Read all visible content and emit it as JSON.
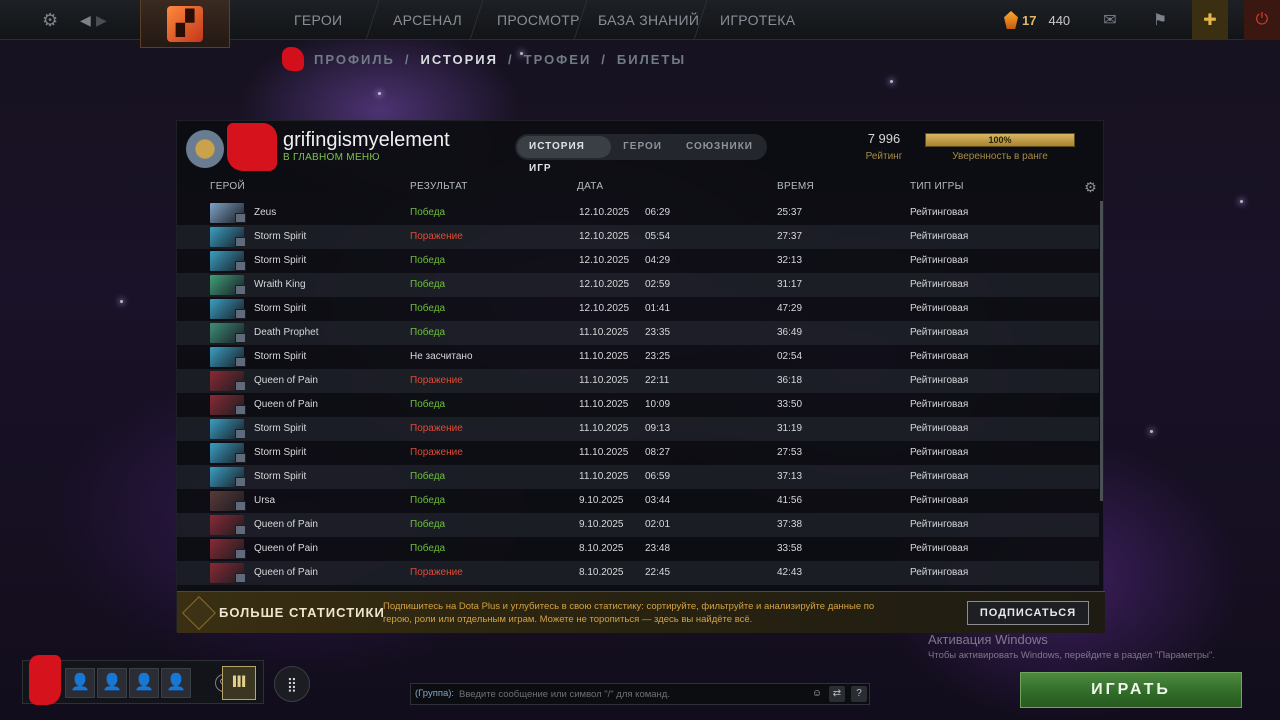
{
  "topbar": {
    "nav": [
      "ГЕРОИ",
      "АРСЕНАЛ",
      "ПРОСМОТР",
      "БАЗА ЗНАНИЙ",
      "ИГРОТЕКА"
    ],
    "currency_level": "17",
    "currency_shards": "440"
  },
  "subnav": {
    "items": [
      "ПРОФИЛЬ",
      "ИСТОРИЯ",
      "ТРОФЕИ",
      "БИЛЕТЫ"
    ],
    "active": "ИСТОРИЯ"
  },
  "profile": {
    "name": "grifingismyelement",
    "status": "В ГЛАВНОМ МЕНЮ",
    "tabs": [
      "ИСТОРИЯ ИГР",
      "ГЕРОИ",
      "СОЮЗНИКИ"
    ],
    "active_tab": "ИСТОРИЯ ИГР",
    "rating_value": "7 996",
    "rating_label": "Рейтинг",
    "confidence_fraction": 1.0,
    "confidence_text": "100%",
    "confidence_label": "Уверенность в ранге"
  },
  "table": {
    "headers": {
      "hero": "ГЕРОЙ",
      "result": "РЕЗУЛЬТАТ",
      "date": "ДАТА",
      "duration": "ВРЕМЯ",
      "type": "ТИП ИГРЫ"
    },
    "rows": [
      {
        "hero": "Zeus",
        "result": "Победа",
        "status": "win",
        "date": "12.10.2025",
        "time": "06:29",
        "duration": "25:37",
        "type": "Рейтинговая",
        "color": "#7fa3c8"
      },
      {
        "hero": "Storm Spirit",
        "result": "Поражение",
        "status": "loss",
        "date": "12.10.2025",
        "time": "05:54",
        "duration": "27:37",
        "type": "Рейтинговая",
        "color": "#3a9fc4"
      },
      {
        "hero": "Storm Spirit",
        "result": "Победа",
        "status": "win",
        "date": "12.10.2025",
        "time": "04:29",
        "duration": "32:13",
        "type": "Рейтинговая",
        "color": "#3a9fc4"
      },
      {
        "hero": "Wraith King",
        "result": "Победа",
        "status": "win",
        "date": "12.10.2025",
        "time": "02:59",
        "duration": "31:17",
        "type": "Рейтинговая",
        "color": "#3fa07a"
      },
      {
        "hero": "Storm Spirit",
        "result": "Победа",
        "status": "win",
        "date": "12.10.2025",
        "time": "01:41",
        "duration": "47:29",
        "type": "Рейтинговая",
        "color": "#3a9fc4"
      },
      {
        "hero": "Death Prophet",
        "result": "Победа",
        "status": "win",
        "date": "11.10.2025",
        "time": "23:35",
        "duration": "36:49",
        "type": "Рейтинговая",
        "color": "#3d8f7a"
      },
      {
        "hero": "Storm Spirit",
        "result": "Не засчитано",
        "status": "nc",
        "date": "11.10.2025",
        "time": "23:25",
        "duration": "02:54",
        "type": "Рейтинговая",
        "color": "#3a9fc4"
      },
      {
        "hero": "Queen of Pain",
        "result": "Поражение",
        "status": "loss",
        "date": "11.10.2025",
        "time": "22:11",
        "duration": "36:18",
        "type": "Рейтинговая",
        "color": "#8a2a34"
      },
      {
        "hero": "Queen of Pain",
        "result": "Победа",
        "status": "win",
        "date": "11.10.2025",
        "time": "10:09",
        "duration": "33:50",
        "type": "Рейтинговая",
        "color": "#8a2a34"
      },
      {
        "hero": "Storm Spirit",
        "result": "Поражение",
        "status": "loss",
        "date": "11.10.2025",
        "time": "09:13",
        "duration": "31:19",
        "type": "Рейтинговая",
        "color": "#3a9fc4"
      },
      {
        "hero": "Storm Spirit",
        "result": "Поражение",
        "status": "loss",
        "date": "11.10.2025",
        "time": "08:27",
        "duration": "27:53",
        "type": "Рейтинговая",
        "color": "#3a9fc4"
      },
      {
        "hero": "Storm Spirit",
        "result": "Победа",
        "status": "win",
        "date": "11.10.2025",
        "time": "06:59",
        "duration": "37:13",
        "type": "Рейтинговая",
        "color": "#3a9fc4"
      },
      {
        "hero": "Ursa",
        "result": "Победа",
        "status": "win",
        "date": "9.10.2025",
        "time": "03:44",
        "duration": "41:56",
        "type": "Рейтинговая",
        "color": "#5a3a3a"
      },
      {
        "hero": "Queen of Pain",
        "result": "Победа",
        "status": "win",
        "date": "9.10.2025",
        "time": "02:01",
        "duration": "37:38",
        "type": "Рейтинговая",
        "color": "#8a2a34"
      },
      {
        "hero": "Queen of Pain",
        "result": "Победа",
        "status": "win",
        "date": "8.10.2025",
        "time": "23:48",
        "duration": "33:58",
        "type": "Рейтинговая",
        "color": "#8a2a34"
      },
      {
        "hero": "Queen of Pain",
        "result": "Поражение",
        "status": "loss",
        "date": "8.10.2025",
        "time": "22:45",
        "duration": "42:43",
        "type": "Рейтинговая",
        "color": "#8a2a34"
      }
    ]
  },
  "promo": {
    "title": "БОЛЬШЕ СТАТИСТИКИ",
    "description": "Подпишитесь на Dota Plus и углубитесь в свою статистику: сортируйте, фильтруйте и анализируйте данные по герою, роли или отдельным играм. Можете не торопиться — здесь вы найдёте всё.",
    "button": "ПОДПИСАТЬСЯ"
  },
  "windows": {
    "title": "Активация Windows",
    "subtitle": "Чтобы активировать Windows, перейдите в раздел \"Параметры\"."
  },
  "chat": {
    "channel": "(Группа):",
    "placeholder": "Введите сообщение или символ \"/\" для команд."
  },
  "play_button": "ИГРАТЬ",
  "colors": {
    "win": "#6fbf3a",
    "loss": "#e04a34",
    "accent_gold": "#a58b45",
    "play_green": "#2f6a27"
  }
}
